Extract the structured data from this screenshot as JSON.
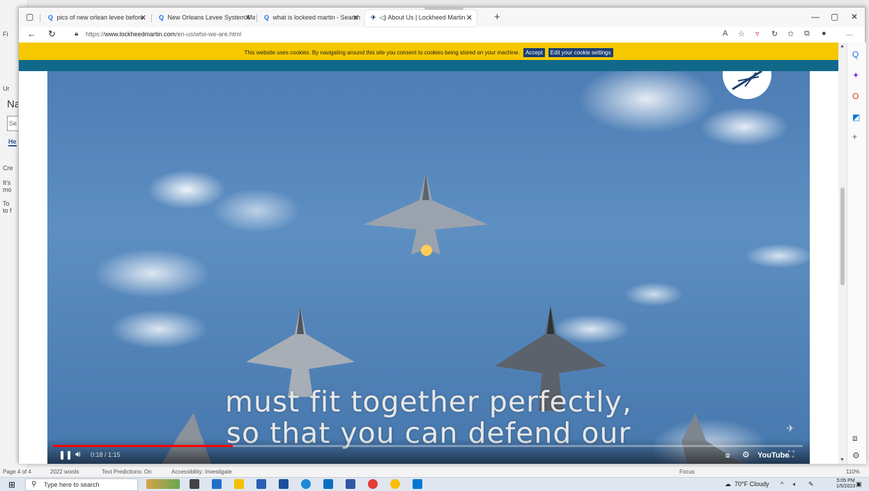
{
  "word_bg": {
    "nav_label": "Na",
    "search_placeholder": "Se",
    "tab_label": "He",
    "frag_1": "Cre",
    "frag_2": "It's",
    "frag_3": "mo",
    "frag_4": "To",
    "frag_5": "to f",
    "status": {
      "page": "Page 4 of 4",
      "words": "2022 words",
      "predictions": "Text Predictions: On",
      "accessibility": "Accessibility: Investigate",
      "focus": "Focus",
      "zoom": "110%"
    }
  },
  "tabs": [
    {
      "label": "pics of new orlean levee before",
      "icon": "search-icon"
    },
    {
      "label": "New Orleans Levee System Map",
      "icon": "search-icon"
    },
    {
      "label": "what is lockeed martin - Search",
      "icon": "search-icon"
    },
    {
      "label": "About Us | Lockheed Martin",
      "icon": "lockheed-favicon",
      "active": true
    }
  ],
  "address": {
    "prefix": "https://",
    "domain": "www.lockheedmartin.com",
    "path": "/en-us/who-we-are.html"
  },
  "cookie": {
    "message": "This website uses cookies. By navigating around this site you consent to cookies being stored on your machine.",
    "accept": "Accept",
    "settings": "Edit your cookie settings"
  },
  "video": {
    "caption_line1": "must fit together perfectly,",
    "caption_line2": "so that you can defend our",
    "time": "0:18 / 1:15",
    "progress_fraction": 0.24,
    "youtube_label": "YouTube"
  },
  "taskbar": {
    "search_placeholder": "Type here to search",
    "weather": "70°F  Cloudy",
    "time": "5:05 PM",
    "date": "1/5/2023"
  },
  "colors": {
    "cookie_bg": "#f6c800",
    "teal": "#11698a",
    "progress": "#ff0000"
  }
}
